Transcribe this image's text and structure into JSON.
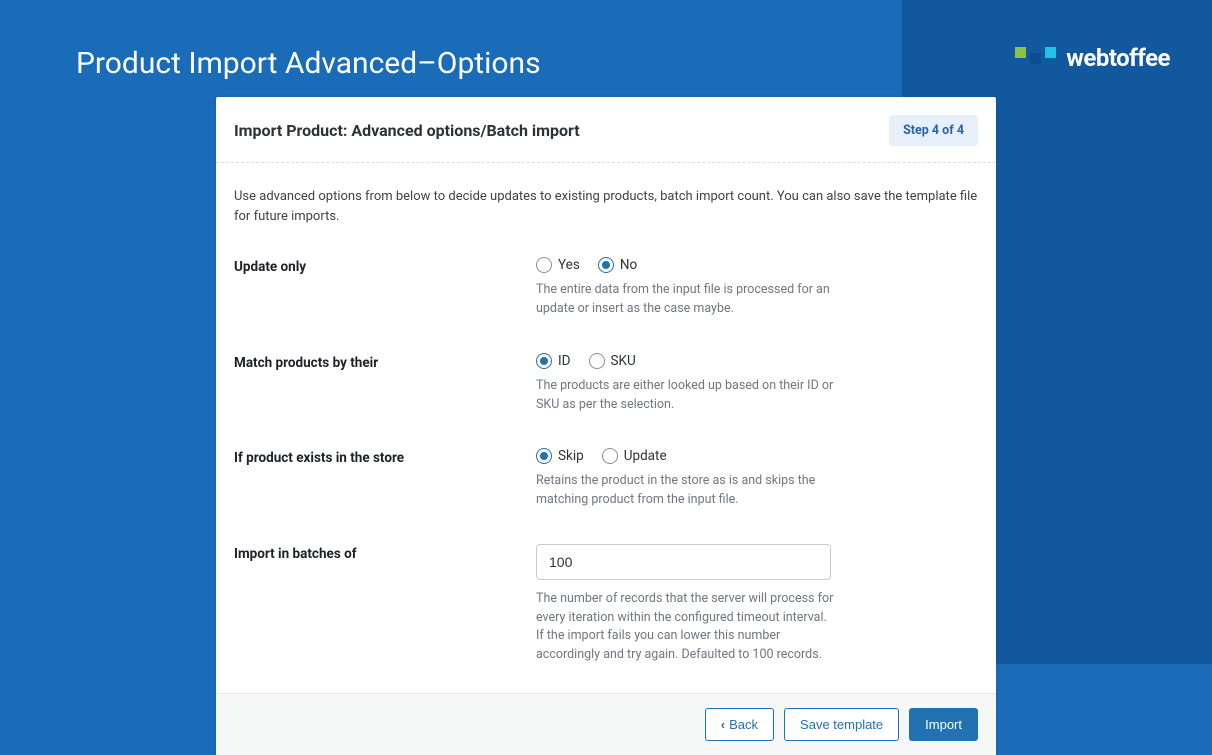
{
  "pageTitle": "Product Import Advanced–Options",
  "brand": "webtoffee",
  "card": {
    "title": "Import Product: Advanced options/Batch import",
    "stepBadge": "Step 4 of 4",
    "description": "Use advanced options from below to decide updates to existing products, batch import count. You can also save the template file for future imports."
  },
  "fields": {
    "updateOnly": {
      "label": "Update only",
      "opt1": "Yes",
      "opt2": "No",
      "selected": "No",
      "help": "The entire data from the input file is processed for an update or insert as the case maybe."
    },
    "matchBy": {
      "label": "Match products by their",
      "opt1": "ID",
      "opt2": "SKU",
      "selected": "ID",
      "help": "The products are either looked up based on their ID or SKU as per the selection."
    },
    "ifExists": {
      "label": "If product exists in the store",
      "opt1": "Skip",
      "opt2": "Update",
      "selected": "Skip",
      "help": "Retains the product in the store as is and skips the matching product from the input file."
    },
    "batches": {
      "label": "Import in batches of",
      "value": "100",
      "help": "The number of records that the server will process for every iteration within the configured timeout interval. If the import fails you can lower this number accordingly and try again. Defaulted to 100 records."
    }
  },
  "footer": {
    "back": "Back",
    "save": "Save template",
    "import": "Import"
  }
}
